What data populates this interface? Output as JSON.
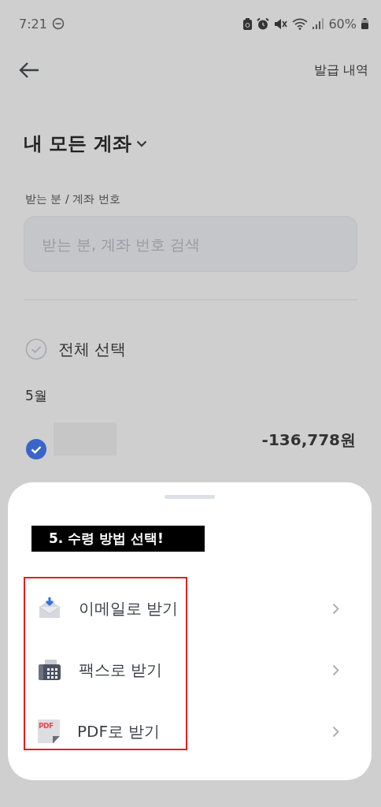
{
  "status_bar": {
    "time": "7:21",
    "battery": "60%"
  },
  "header": {
    "action": "발급 내역"
  },
  "account_selector": {
    "label": "내 모든 계좌"
  },
  "search": {
    "label": "받는 분 / 계좌 번호",
    "placeholder": "받는 분, 계좌 번호 검색"
  },
  "select_all": {
    "label": "전체 선택",
    "checked": false
  },
  "month": "5월",
  "transactions": [
    {
      "amount": "-136,778원",
      "checked": true
    }
  ],
  "sheet": {
    "annotation": "5. 수령 방법 선택!",
    "options": [
      {
        "kind": "email",
        "label": "이메일로 받기"
      },
      {
        "kind": "fax",
        "label": "팩스로 받기"
      },
      {
        "kind": "pdf",
        "label": "PDF로 받기",
        "icon_text": "PDF"
      }
    ]
  }
}
